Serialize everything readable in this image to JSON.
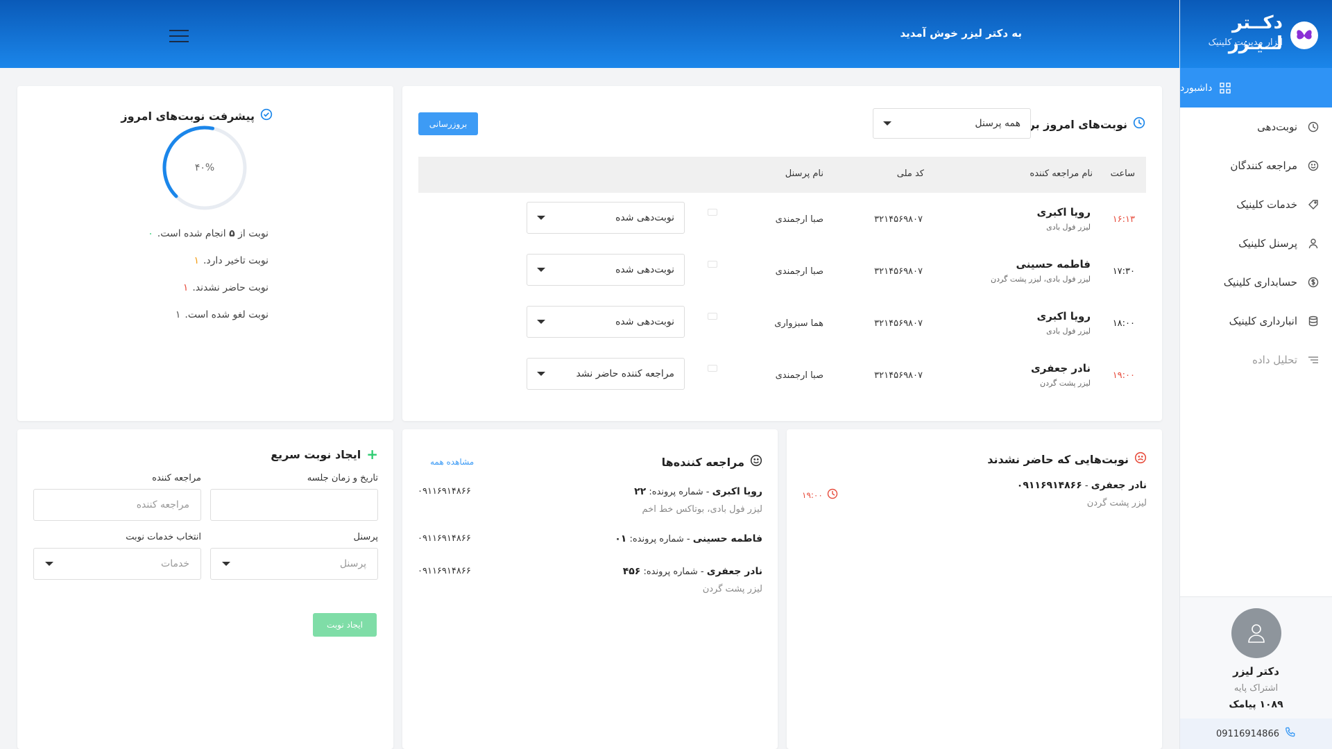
{
  "header": {
    "welcome": "به دکتر لیزر خوش آمدید"
  },
  "brand": {
    "title": "دکــتر لــیـزر",
    "subtitle": "ابزار مدیریت کلینیک"
  },
  "sidebar": {
    "items": [
      {
        "label": "داشبورد",
        "icon": "grid-icon"
      },
      {
        "label": "نوبت‌دهی",
        "icon": "clock-icon"
      },
      {
        "label": "مراجعه کنندگان",
        "icon": "smile-icon"
      },
      {
        "label": "خدمات کلینیک",
        "icon": "tag-icon"
      },
      {
        "label": "پرسنل کلینیک",
        "icon": "user-icon"
      },
      {
        "label": "حسابداری کلینیک",
        "icon": "dollar-icon"
      },
      {
        "label": "انبارداری کلینیک",
        "icon": "database-icon"
      },
      {
        "label": "تحلیل داده",
        "icon": "filter-icon"
      }
    ]
  },
  "profile": {
    "name": "دکتر لیزر",
    "plan": "اشتراک پایه",
    "sms": "۱۰۸۹ پیامک",
    "phone": "09116914866"
  },
  "appointments": {
    "title": "نوبت‌های امروز برای",
    "staff_filter": "همه پرسنل",
    "update_label": "بروزرسانی",
    "columns": {
      "time": "ساعت",
      "client": "نام مراجعه کننده",
      "code": "کد ملی",
      "staff": "نام پرسنل"
    },
    "rows": [
      {
        "time": "۱۶:۱۳",
        "name": "رویا اکبری",
        "service": "لیزر فول بادی",
        "code": "۳۲۱۴۵۶۹۸۰۷",
        "staff": "صبا ارجمندی",
        "status": "نوبت‌دهی شده",
        "red": true
      },
      {
        "time": "۱۷:۳۰",
        "name": "فاطمه حسینی",
        "service": "لیزر فول بادی، لیزر پشت گردن",
        "code": "۳۲۱۴۵۶۹۸۰۷",
        "staff": "صبا ارجمندی",
        "status": "نوبت‌دهی شده",
        "red": false
      },
      {
        "time": "۱۸:۰۰",
        "name": "رویا اکبری",
        "service": "لیزر فول بادی",
        "code": "۳۲۱۴۵۶۹۸۰۷",
        "staff": "هما سبزواری",
        "status": "نوبت‌دهی شده",
        "red": false
      },
      {
        "time": "۱۹:۰۰",
        "name": "نادر جعفری",
        "service": "لیزر پشت گردن",
        "code": "۳۲۱۴۵۶۹۸۰۷",
        "staff": "صبا ارجمندی",
        "status": "مراجعه کننده حاضر نشد",
        "red": true
      }
    ]
  },
  "progress": {
    "title": "پیشرفت نوبت‌های امروز",
    "value_label": "۴۰%",
    "value_fraction": 0.4,
    "stats": [
      {
        "prefix": "۰",
        "text": "نوبت از ",
        "bold": "۵",
        "suffix": " انجام شده است.",
        "bullet_color": "#2ecc71"
      },
      {
        "prefix": "۱",
        "text": "نوبت تاخیر دارد.",
        "color": "#f39c12"
      },
      {
        "prefix": "۱",
        "text": "نوبت حاضر نشدند.",
        "color": "#e74c3c"
      },
      {
        "prefix": "۱",
        "text": "نوبت لغو شده است.",
        "color": "#555"
      }
    ]
  },
  "noshow": {
    "title": "نوبت‌هایی که حاضر نشدند",
    "item": {
      "name": "نادر جعفری",
      "phone": "۰۹۱۱۶۹۱۴۸۶۶",
      "service": "لیزر پشت گردن",
      "time": "۱۹:۰۰"
    }
  },
  "clients": {
    "title": "مراجعه کننده‌ها",
    "view_all": "مشاهده همه",
    "file_label": "شماره پرونده:",
    "items": [
      {
        "name": "رویا اکبری",
        "file": "۲۲",
        "services": "لیزر فول بادی، بوتاکس خط اخم",
        "phone": "۰۹۱۱۶۹۱۴۸۶۶"
      },
      {
        "name": "فاطمه حسینی",
        "file": "۰۱",
        "services": "",
        "phone": "۰۹۱۱۶۹۱۴۸۶۶"
      },
      {
        "name": "نادر جعفری",
        "file": "۴۵۶",
        "services": "لیزر پشت گردن",
        "phone": "۰۹۱۱۶۹۱۴۸۶۶"
      }
    ]
  },
  "quick": {
    "title": "ایجاد نوبت سریع",
    "client_label": "مراجعه کننده",
    "client_placeholder": "مراجعه کننده",
    "date_label": "تاریخ و زمان جلسه",
    "date_value": "",
    "services_label": "انتخاب خدمات نوبت",
    "services_placeholder": "خدمات",
    "staff_label": "پرسنل",
    "staff_placeholder": "پرسنل",
    "create_label": "ایجاد نوبت"
  },
  "colors": {
    "primary": "#1b86ea",
    "accent": "#2f93f5",
    "danger": "#e74c3c",
    "success": "#2ecc71"
  }
}
